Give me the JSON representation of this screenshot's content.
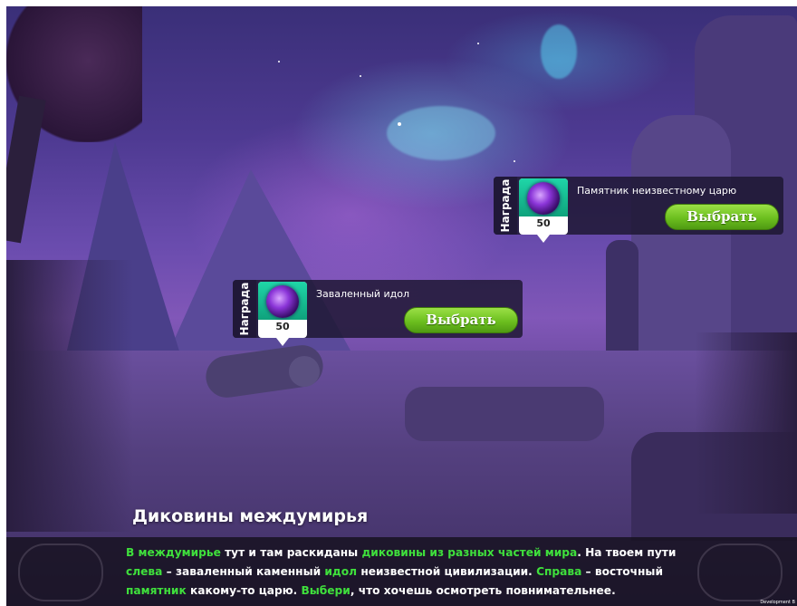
{
  "scene": {
    "title": "Диковины междумирья",
    "watermark": "Development B"
  },
  "cards": [
    {
      "tab_label": "Награда",
      "reward_count": "50",
      "reward_icon": "dark-portal-orb-icon",
      "title": "Памятник неизвестному царю",
      "button_label": "Выбрать"
    },
    {
      "tab_label": "Награда",
      "reward_count": "50",
      "reward_icon": "dark-portal-orb-icon",
      "title": "Заваленный идол",
      "button_label": "Выбрать"
    }
  ],
  "narration": {
    "segments": [
      {
        "text": "В междумирье",
        "highlight": true
      },
      {
        "text": " тут и там раскиданы ",
        "highlight": false
      },
      {
        "text": "диковины из разных частей мира",
        "highlight": true
      },
      {
        "text": ". На твоем пути ",
        "highlight": false
      },
      {
        "text": "слева",
        "highlight": true
      },
      {
        "text": " – заваленный каменный ",
        "highlight": false
      },
      {
        "text": "идол",
        "highlight": true
      },
      {
        "text": " неизвестной цивилизации. ",
        "highlight": false
      },
      {
        "text": "Справа",
        "highlight": true
      },
      {
        "text": " – восточный ",
        "highlight": false
      },
      {
        "text": "памятник",
        "highlight": true
      },
      {
        "text": " какому-то царю. ",
        "highlight": false
      },
      {
        "text": "Выбери",
        "highlight": true
      },
      {
        "text": ", что хочешь осмотреть повнимательнее.",
        "highlight": false
      }
    ]
  },
  "colors": {
    "highlight": "#3fe03c",
    "button": "#6cbf1f",
    "reward_bg": "#0fa27c"
  }
}
